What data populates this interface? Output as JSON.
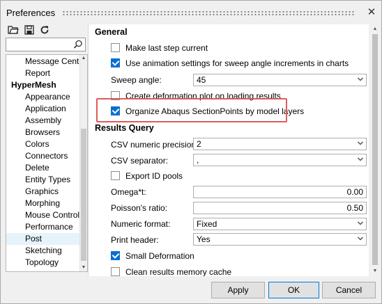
{
  "window": {
    "title": "Preferences"
  },
  "toolbar": {
    "icons": [
      "folder-open-icon",
      "save-icon",
      "refresh-icon"
    ]
  },
  "tree": {
    "items": [
      {
        "label": "Message Center",
        "level": 1
      },
      {
        "label": "Report",
        "level": 1
      },
      {
        "label": "HyperMesh",
        "level": 0
      },
      {
        "label": "Appearance",
        "level": 1
      },
      {
        "label": "Application",
        "level": 1
      },
      {
        "label": "Assembly",
        "level": 1
      },
      {
        "label": "Browsers",
        "level": 1
      },
      {
        "label": "Colors",
        "level": 1
      },
      {
        "label": "Connectors",
        "level": 1
      },
      {
        "label": "Delete",
        "level": 1
      },
      {
        "label": "Entity Types",
        "level": 1
      },
      {
        "label": "Graphics",
        "level": 1
      },
      {
        "label": "Morphing",
        "level": 1
      },
      {
        "label": "Mouse Controls",
        "level": 1
      },
      {
        "label": "Performance",
        "level": 1
      },
      {
        "label": "Post",
        "level": 1,
        "selected": true
      },
      {
        "label": "Sketching",
        "level": 1
      },
      {
        "label": "Topology",
        "level": 1
      }
    ]
  },
  "general": {
    "heading": "General",
    "make_last_step_current": {
      "label": "Make last step current",
      "checked": false
    },
    "use_animation_settings": {
      "label": "Use animation settings for sweep angle increments in charts",
      "checked": true
    },
    "sweep_angle": {
      "label": "Sweep angle:",
      "value": "45"
    },
    "create_deformation_plot": {
      "label": "Create deformation plot on loading results",
      "checked": false
    },
    "organize_abaqus": {
      "label": "Organize Abaqus SectionPoints by model layers",
      "checked": true
    }
  },
  "results_query": {
    "heading": "Results Query",
    "csv_precision": {
      "label": "CSV numeric precision:",
      "value": "2"
    },
    "csv_separator": {
      "label": "CSV separator:",
      "value": ","
    },
    "export_id_pools": {
      "label": "Export ID pools",
      "checked": false
    },
    "omega": {
      "label": "Omega*t:",
      "value": "0.00"
    },
    "poisson": {
      "label": "Poisson's ratio:",
      "value": "0.50"
    },
    "numeric_format": {
      "label": "Numeric format:",
      "value": "Fixed"
    },
    "print_header": {
      "label": "Print header:",
      "value": "Yes"
    },
    "small_deformation": {
      "label": "Small Deformation",
      "checked": true
    },
    "clean_results_cache": {
      "label": "Clean results memory cache",
      "checked": false
    }
  },
  "buttons": {
    "apply": "Apply",
    "ok": "OK",
    "cancel": "Cancel"
  },
  "colors": {
    "accent": "#0a6ed1",
    "highlight": "#e05a5a",
    "selection": "#e5f3fb"
  }
}
